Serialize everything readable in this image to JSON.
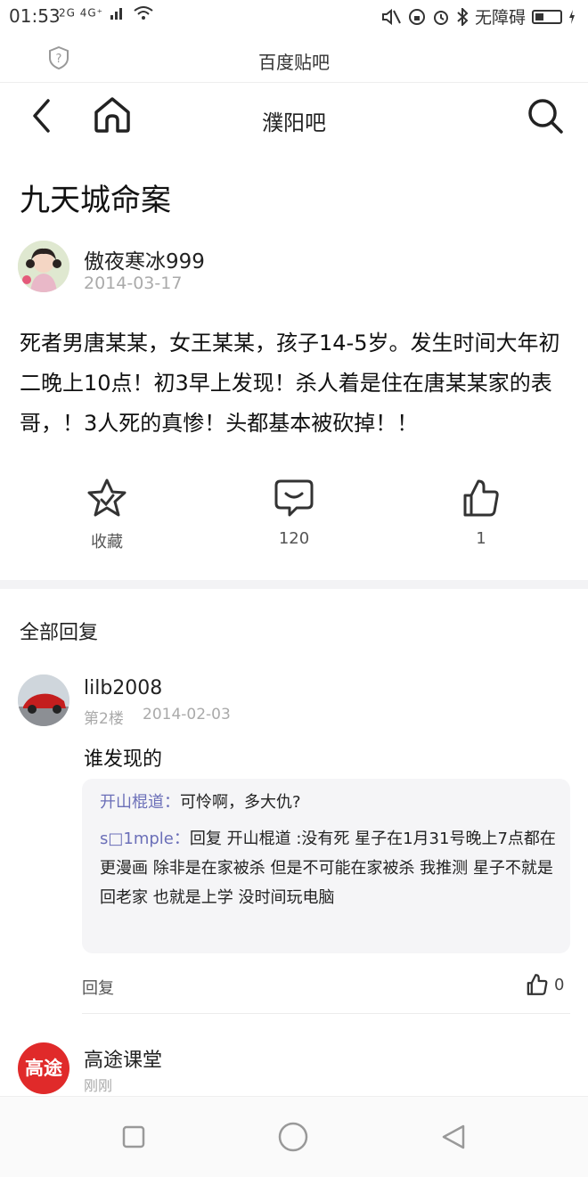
{
  "status_bar": {
    "time": "01:53",
    "signal_text": "2G 4G⁺",
    "accessibility": "无障碍",
    "battery_level": 0.35
  },
  "app": {
    "title": "百度贴吧"
  },
  "nav": {
    "forum_name": "濮阳吧"
  },
  "post": {
    "title": "九天城命案",
    "author": "傲夜寒冰999",
    "date": "2014-03-17",
    "body": "死者男唐某某，女王某某，孩子14-5岁。发生时间大年初二晚上10点！初3早上发现！杀人着是住在唐某某家的表哥，！3人死的真惨！头都基本被砍掉！！"
  },
  "actions": {
    "favorite_label": "收藏",
    "comment_count": "120",
    "like_count": "1"
  },
  "replies": {
    "header": "全部回复",
    "items": [
      {
        "user": "lilb2008",
        "floor": "第2楼",
        "date": "2014-02-03",
        "text": "谁发现的",
        "subreplies": [
          {
            "user": "开山棍道：",
            "text": "可怜啊，多大仇?"
          },
          {
            "user": "s□1mple：",
            "text": "回复 开山棍道 :没有死 星子在1月31号晚上7点都在更漫画 除非是在家被杀 但是不可能在家被杀 我推测 星子不就是回老家 也就是上学 没时间玩电脑"
          }
        ],
        "reply_label": "回复",
        "like_count": "0"
      }
    ]
  },
  "ad": {
    "logo_text": "高途",
    "name": "高途课堂",
    "time": "刚刚"
  }
}
